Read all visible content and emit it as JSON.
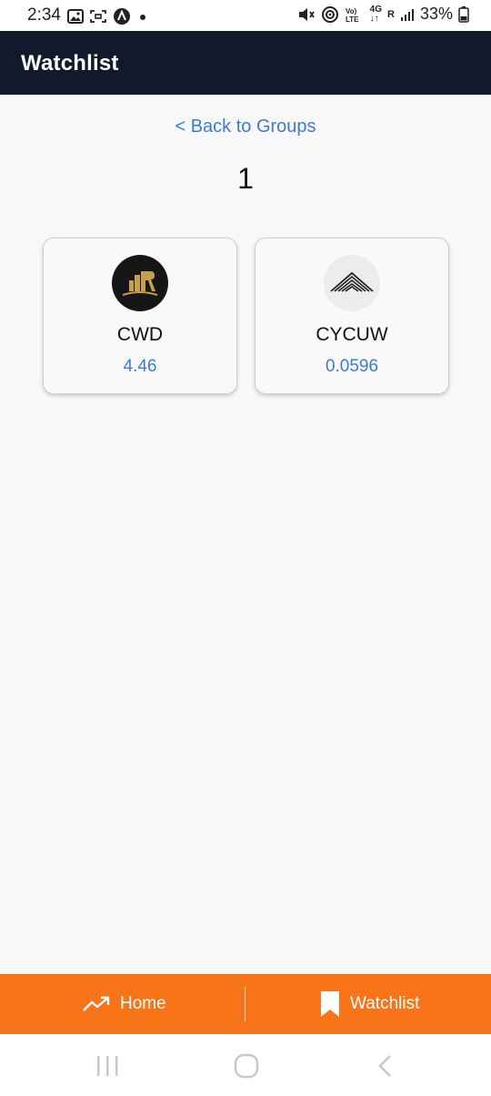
{
  "status_bar": {
    "time": "2:34",
    "network": "4G",
    "roaming": "R",
    "battery": "33%",
    "icons": [
      "gallery-icon",
      "screenshot-icon",
      "app-icon",
      "dot-icon",
      "mute-icon",
      "hotspot-icon",
      "volte-icon",
      "signal-icon",
      "battery-icon"
    ]
  },
  "header": {
    "title": "Watchlist"
  },
  "main": {
    "back_link": "< Back to Groups",
    "group_name": "1",
    "cards": [
      {
        "symbol": "CWD",
        "price": "4.46",
        "logo": "building-logo-icon"
      },
      {
        "symbol": "CYCUW",
        "price": "0.0596",
        "logo": "roof-logo-icon"
      }
    ]
  },
  "bottom_nav": {
    "home_label": "Home",
    "watchlist_label": "Watchlist",
    "home_icon": "trend-up-icon",
    "watchlist_icon": "bookmark-icon"
  },
  "system_nav": {
    "icons": [
      "recents-icon",
      "home-icon",
      "back-icon"
    ]
  },
  "colors": {
    "header_bg": "#111a2b",
    "accent_link": "#3a7bd5",
    "bottom_nav_bg": "#f77419",
    "page_bg": "#f8f8f8"
  }
}
